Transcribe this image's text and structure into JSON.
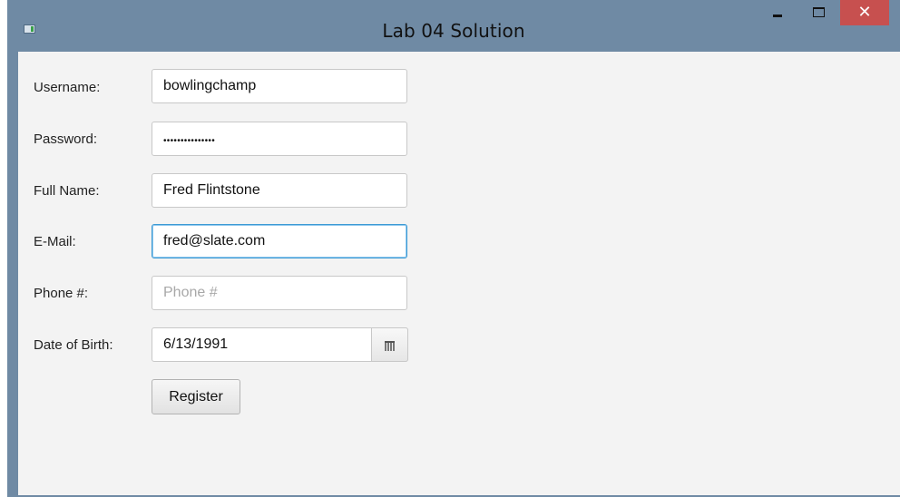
{
  "window": {
    "title": "Lab 04 Solution",
    "close_glyph": "✕"
  },
  "form": {
    "username": {
      "label": "Username:",
      "value": "bowlingchamp"
    },
    "password": {
      "label": "Password:",
      "masked": "•••••••••••••••"
    },
    "full_name": {
      "label": "Full Name:",
      "value": "Fred Flintstone"
    },
    "email": {
      "label": "E-Mail:",
      "value": "fred@slate.com"
    },
    "phone": {
      "label": "Phone #:",
      "value": "",
      "placeholder": "Phone #"
    },
    "dob": {
      "label": "Date of Birth:",
      "value": "6/13/1991"
    },
    "register_label": "Register"
  },
  "colors": {
    "titlebar": "#6f8aa4",
    "close_button": "#c7504f",
    "client_bg": "#f3f3f3",
    "focus_border": "#3d9ad4"
  },
  "icons": {
    "app": "app-window-icon",
    "minimize": "minimize-icon",
    "maximize": "maximize-icon",
    "close": "close-icon",
    "calendar": "calendar-icon"
  }
}
